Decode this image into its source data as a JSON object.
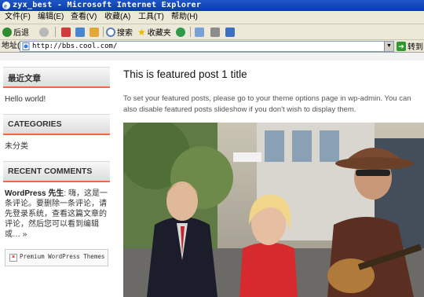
{
  "window": {
    "title": "zyx_best - Microsoft Internet Explorer"
  },
  "menu": [
    "文件(F)",
    "编辑(E)",
    "查看(V)",
    "收藏(A)",
    "工具(T)",
    "帮助(H)"
  ],
  "toolbar": {
    "back_label": "后退",
    "search_label": "搜索",
    "favorites_label": "收藏夹"
  },
  "address": {
    "label": "地址(D)",
    "url": "http://bbs.cool.com/",
    "go_label": "转到"
  },
  "sidebar": {
    "recent_title": "最近文章",
    "recent_item": "Hello world!",
    "categories_title": "CATEGORIES",
    "category_item": "未分类",
    "comments_title": "RECENT COMMENTS",
    "comment_author": "WordPress 先生",
    "comment_text": ": 嗨，这是一条评论。要删除一条评论，请先登录系统，查看这篇文章的评论，然后您可以看到编辑或…",
    "comment_more": "»",
    "badge_alt": "Premium WordPress Themes"
  },
  "post": {
    "title": "This is featured post 1 title",
    "body": "To set your featured posts, please go to your theme options page in wp-admin. You can also disable featured posts slideshow if you don't wish to display them."
  },
  "colors": {
    "accent": "#ef6a3a",
    "titlebar": "#0a3bb0",
    "chrome": "#ece9d8"
  }
}
